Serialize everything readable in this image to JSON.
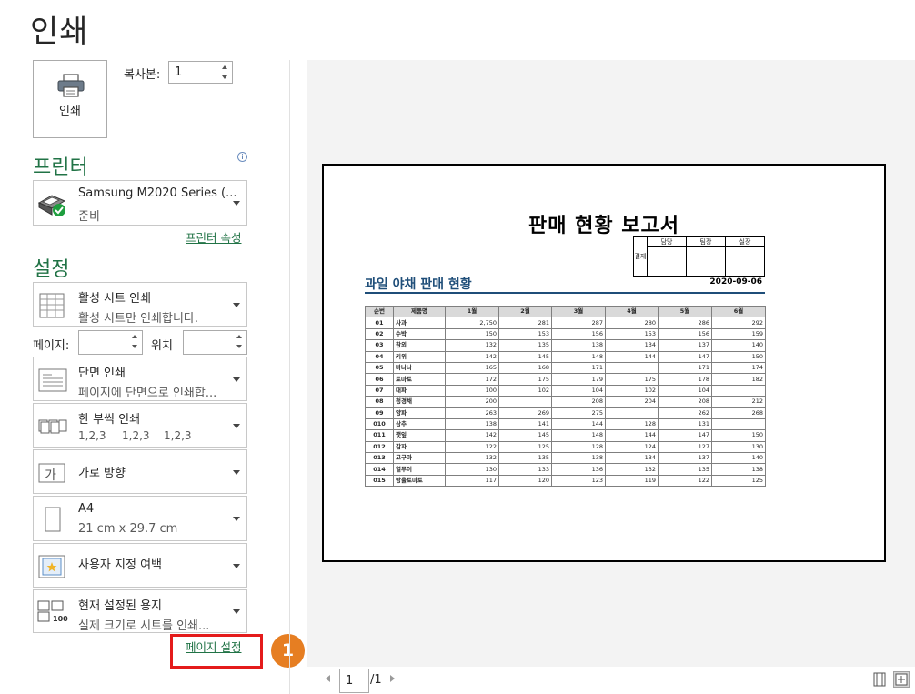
{
  "title": "인쇄",
  "print_button": {
    "label": "인쇄",
    "icon": "printer-icon"
  },
  "copies": {
    "label": "복사본:",
    "value": "1"
  },
  "printer": {
    "section_title": "프린터",
    "name": "Samsung M2020 Series (...",
    "status": "준비",
    "properties_link": "프린터 속성",
    "icon": "printer-ready-icon"
  },
  "settings": {
    "section_title": "설정",
    "print_what": {
      "main": "활성 시트 인쇄",
      "sub": "활성 시트만 인쇄합니다."
    },
    "pages": {
      "label": "페이지:",
      "to_label": "위치",
      "from_value": "",
      "to_value": ""
    },
    "sides": {
      "main": "단면 인쇄",
      "sub": "페이지에 단면으로 인쇄합..."
    },
    "collate": {
      "main": "한 부씩 인쇄",
      "sub": [
        "1,2,3",
        "1,2,3",
        "1,2,3"
      ]
    },
    "orientation": {
      "main": "가로 방향",
      "icon_text": "가"
    },
    "paper": {
      "main": "A4",
      "sub": "21 cm x 29.7 cm"
    },
    "margins": {
      "main": "사용자 지정 여백"
    },
    "scaling": {
      "main": "현재 설정된 용지",
      "sub": "실제 크기로 시트를 인쇄...",
      "icon_text": "100"
    },
    "page_setup_link": "페이지 설정"
  },
  "annotation": {
    "number": "1",
    "color": "#e67e22",
    "box_color": "#e41b1b"
  },
  "preview": {
    "report_title": "판매 현황 보고서",
    "approval": {
      "side_label": "결재",
      "headers": [
        "담당",
        "팀장",
        "실장"
      ]
    },
    "subtitle": "과일 야채 판매 현황",
    "date": "2020-09-06",
    "table": {
      "headers": [
        "순번",
        "제품명",
        "1월",
        "2월",
        "3월",
        "4월",
        "5월",
        "6월"
      ],
      "rows": [
        [
          "01",
          "사과",
          "2,750",
          "281",
          "287",
          "280",
          "286",
          "292"
        ],
        [
          "02",
          "수박",
          "150",
          "153",
          "156",
          "153",
          "156",
          "159"
        ],
        [
          "03",
          "참외",
          "132",
          "135",
          "138",
          "134",
          "137",
          "140"
        ],
        [
          "04",
          "키위",
          "142",
          "145",
          "148",
          "144",
          "147",
          "150"
        ],
        [
          "05",
          "바나나",
          "165",
          "168",
          "171",
          "",
          "171",
          "174"
        ],
        [
          "06",
          "토마토",
          "172",
          "175",
          "179",
          "175",
          "178",
          "182"
        ],
        [
          "07",
          "대파",
          "100",
          "102",
          "104",
          "102",
          "104",
          ""
        ],
        [
          "08",
          "청경채",
          "200",
          "",
          "208",
          "204",
          "208",
          "212"
        ],
        [
          "09",
          "양파",
          "263",
          "269",
          "275",
          "",
          "262",
          "268"
        ],
        [
          "010",
          "상추",
          "138",
          "141",
          "144",
          "128",
          "131",
          ""
        ],
        [
          "011",
          "깻잎",
          "142",
          "145",
          "148",
          "144",
          "147",
          "150"
        ],
        [
          "012",
          "감자",
          "122",
          "125",
          "128",
          "124",
          "127",
          "130"
        ],
        [
          "013",
          "고구마",
          "132",
          "135",
          "138",
          "134",
          "137",
          "140"
        ],
        [
          "014",
          "열무이",
          "130",
          "133",
          "136",
          "132",
          "135",
          "138"
        ],
        [
          "015",
          "방울토마토",
          "117",
          "120",
          "123",
          "119",
          "122",
          "125"
        ]
      ]
    }
  },
  "pager": {
    "current": "1",
    "total": "/1"
  },
  "colors": {
    "accent": "#217346",
    "report_blue": "#1f4e79"
  }
}
